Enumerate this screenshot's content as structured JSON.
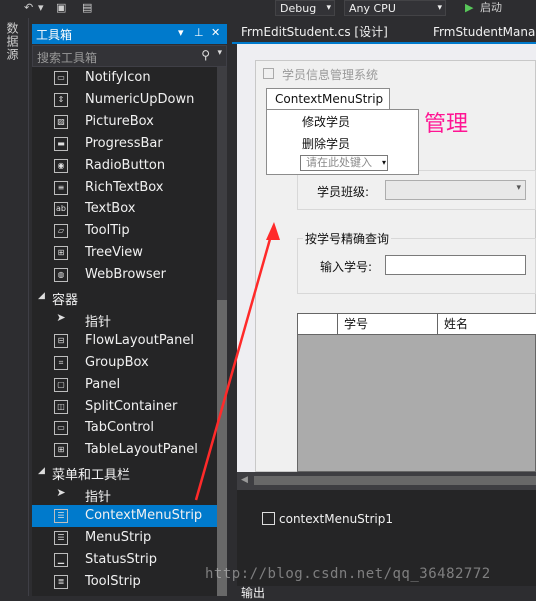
{
  "toolbar": {
    "config": "Debug",
    "platform": "Any CPU",
    "start_label": "启动"
  },
  "left_strip": {
    "label": "数据源"
  },
  "toolbox": {
    "title": "工具箱",
    "search_placeholder": "搜索工具箱",
    "items": [
      {
        "label": "NotifyIcon",
        "icon": "notifyicon-icon",
        "kind": "item"
      },
      {
        "label": "NumericUpDown",
        "icon": "numericupdown-icon",
        "kind": "item"
      },
      {
        "label": "PictureBox",
        "icon": "picturebox-icon",
        "kind": "item"
      },
      {
        "label": "ProgressBar",
        "icon": "progressbar-icon",
        "kind": "item"
      },
      {
        "label": "RadioButton",
        "icon": "radiobutton-icon",
        "kind": "item"
      },
      {
        "label": "RichTextBox",
        "icon": "richtextbox-icon",
        "kind": "item"
      },
      {
        "label": "TextBox",
        "icon": "textbox-icon",
        "kind": "item"
      },
      {
        "label": "ToolTip",
        "icon": "tooltip-icon",
        "kind": "item"
      },
      {
        "label": "TreeView",
        "icon": "treeview-icon",
        "kind": "item"
      },
      {
        "label": "WebBrowser",
        "icon": "webbrowser-icon",
        "kind": "item"
      },
      {
        "label": "容器",
        "icon": "collapse-triangle-icon",
        "kind": "category"
      },
      {
        "label": "指针",
        "icon": "pointer-icon",
        "kind": "item"
      },
      {
        "label": "FlowLayoutPanel",
        "icon": "flowlayoutpanel-icon",
        "kind": "item"
      },
      {
        "label": "GroupBox",
        "icon": "groupbox-icon",
        "kind": "item"
      },
      {
        "label": "Panel",
        "icon": "panel-icon",
        "kind": "item"
      },
      {
        "label": "SplitContainer",
        "icon": "splitcontainer-icon",
        "kind": "item"
      },
      {
        "label": "TabControl",
        "icon": "tabcontrol-icon",
        "kind": "item"
      },
      {
        "label": "TableLayoutPanel",
        "icon": "tablelayoutpanel-icon",
        "kind": "item"
      },
      {
        "label": "菜单和工具栏",
        "icon": "collapse-triangle-icon",
        "kind": "category"
      },
      {
        "label": "指针",
        "icon": "pointer-icon",
        "kind": "item"
      },
      {
        "label": "ContextMenuStrip",
        "icon": "contextmenustrip-icon",
        "kind": "item",
        "selected": true
      },
      {
        "label": "MenuStrip",
        "icon": "menustrip-icon",
        "kind": "item"
      },
      {
        "label": "StatusStrip",
        "icon": "statusstrip-icon",
        "kind": "item"
      },
      {
        "label": "ToolStrip",
        "icon": "toolstrip-icon",
        "kind": "item"
      }
    ]
  },
  "tabs": [
    {
      "label": "FrmEditStudent.cs [设计]"
    },
    {
      "label": "FrmStudentManag"
    }
  ],
  "designer": {
    "form_title": "学员信息管理系统",
    "big_title": "管理",
    "context_menu": {
      "header": "ContextMenuStrip",
      "items": [
        "修改学员",
        "删除学员"
      ],
      "input_placeholder": "请在此处键入"
    },
    "class_label": "学员班级:",
    "exact_query_group": "按学号精确查询",
    "input_id_label": "输入学号:",
    "grid_headers": [
      "学号",
      "姓名"
    ]
  },
  "component_tray": {
    "item": "contextMenuStrip1"
  },
  "bottom_tab": "输出",
  "watermark": "http://blog.csdn.net/qq_36482772",
  "colors": {
    "accent": "#007acc",
    "arrow": "#ff2a2a",
    "title_pink": "#ff1493"
  }
}
